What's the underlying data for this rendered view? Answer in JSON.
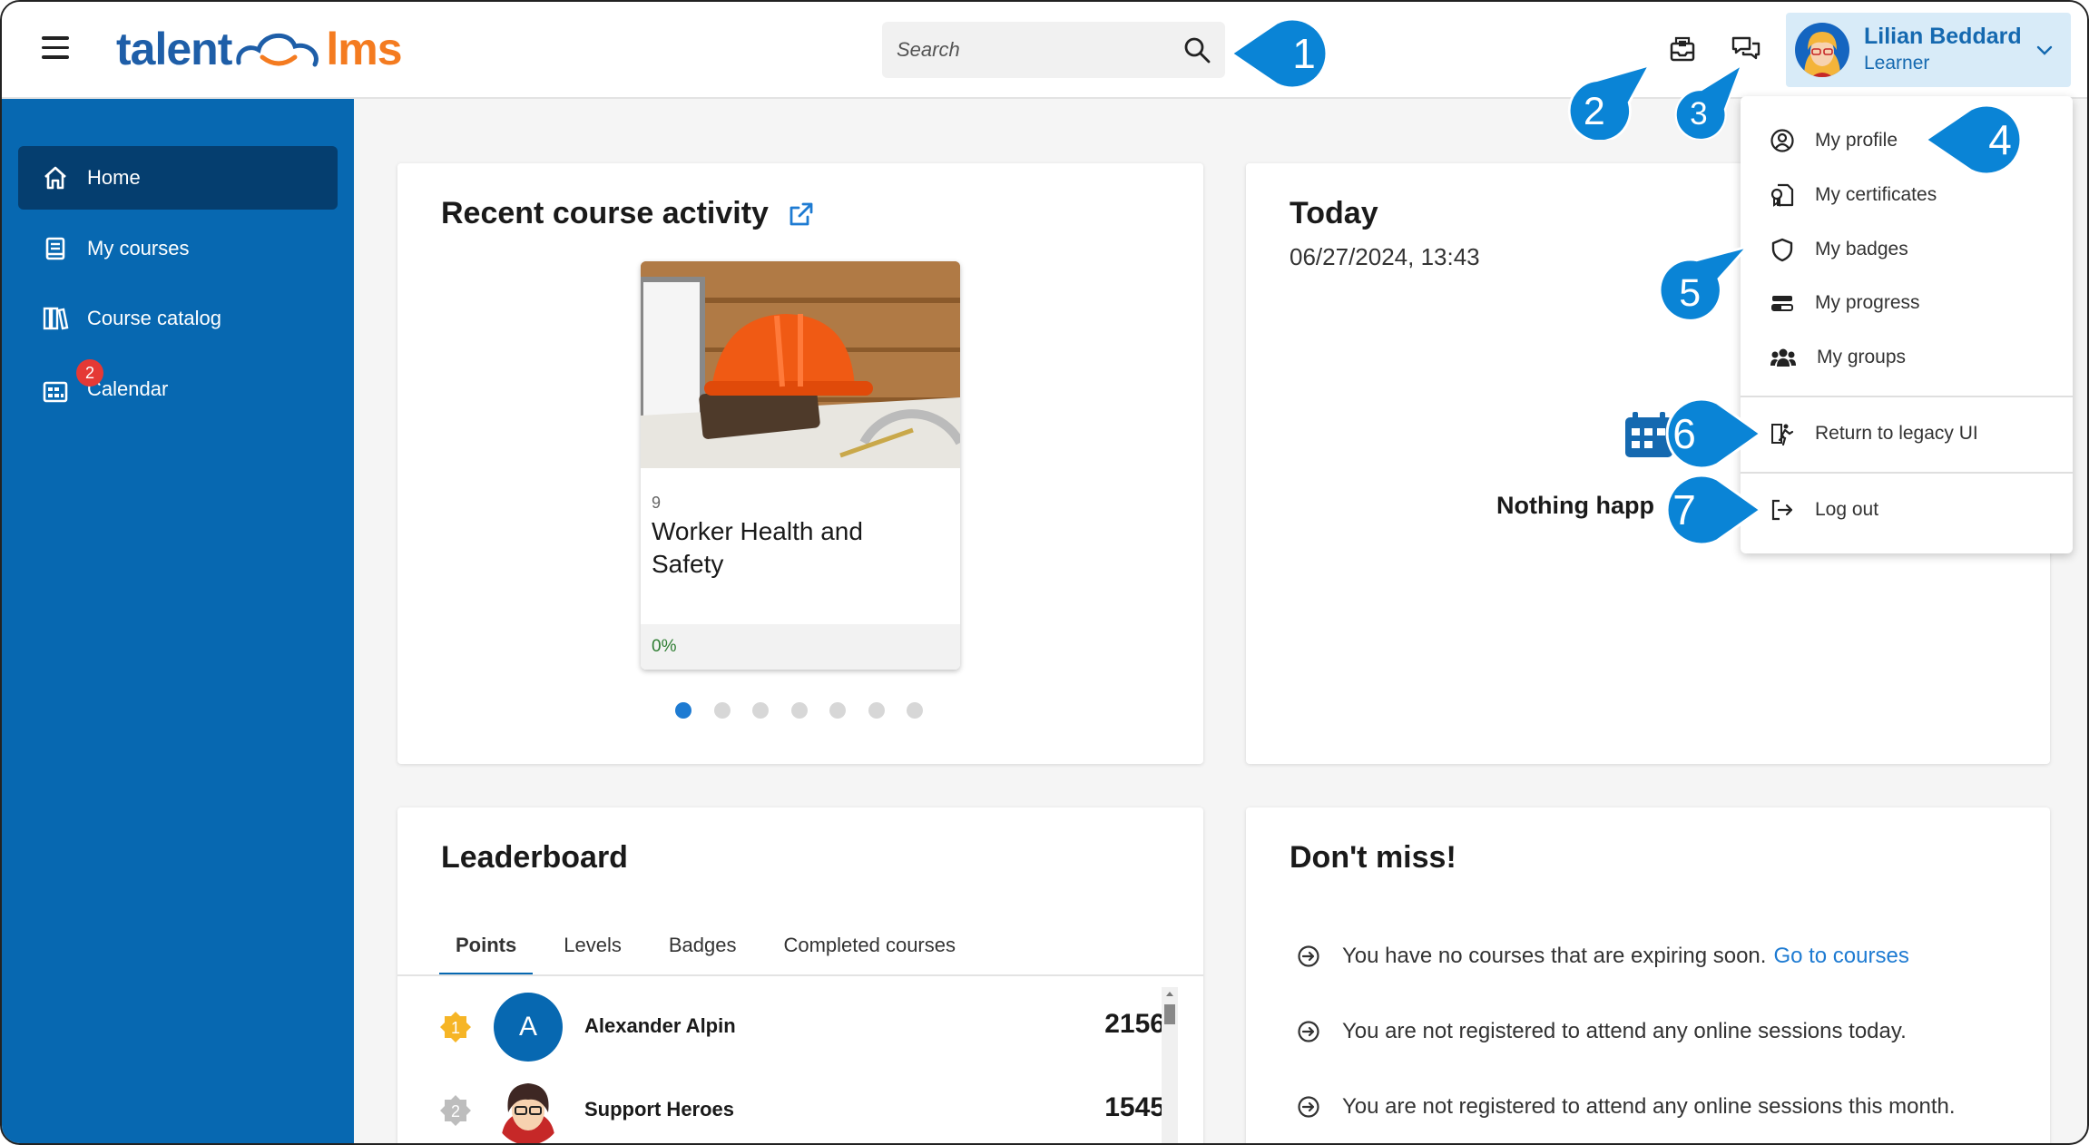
{
  "header": {
    "logo_part1": "talent",
    "logo_part2": "lms",
    "search_placeholder": "Search",
    "user": {
      "name": "Lilian Beddard",
      "role": "Learner"
    }
  },
  "sidebar": {
    "items": [
      {
        "label": "Home",
        "icon": "home-icon",
        "active": true
      },
      {
        "label": "My courses",
        "icon": "book-icon"
      },
      {
        "label": "Course catalog",
        "icon": "library-icon"
      },
      {
        "label": "Calendar",
        "icon": "calendar-icon",
        "badge": "2"
      }
    ]
  },
  "recent": {
    "title": "Recent course activity",
    "course": {
      "number": "9",
      "name": "Worker Health and Safety",
      "progress": "0%"
    },
    "pager": {
      "count": 7,
      "active": 1
    }
  },
  "today": {
    "title": "Today",
    "datetime": "06/27/2024, 13:43",
    "empty_text": "Nothing happ"
  },
  "leaderboard": {
    "title": "Leaderboard",
    "tabs": [
      "Points",
      "Levels",
      "Badges",
      "Completed courses"
    ],
    "active_tab": "Points",
    "rows": [
      {
        "rank": "1",
        "initial": "A",
        "name": "Alexander Alpin",
        "score": "2156"
      },
      {
        "rank": "2",
        "initial": "",
        "name": "Support Heroes",
        "score": "1545"
      }
    ]
  },
  "dontmiss": {
    "title": "Don't miss!",
    "items": [
      {
        "text": "You have no courses that are expiring soon.",
        "link": "Go to courses"
      },
      {
        "text": "You are not registered to attend any online sessions today.",
        "link": ""
      },
      {
        "text": "You are not registered to attend any online sessions this month.",
        "link": ""
      }
    ]
  },
  "dropdown": {
    "items": [
      {
        "label": "My profile",
        "icon": "user-circle-icon"
      },
      {
        "label": "My certificates",
        "icon": "certificate-icon"
      },
      {
        "label": "My badges",
        "icon": "shield-icon"
      },
      {
        "label": "My progress",
        "icon": "progress-icon"
      },
      {
        "label": "My groups",
        "icon": "group-icon"
      },
      {
        "label": "Return to legacy UI",
        "icon": "legacy-icon"
      },
      {
        "label": "Log out",
        "icon": "logout-icon"
      }
    ]
  },
  "callouts": [
    "1",
    "2",
    "3",
    "4",
    "5",
    "6",
    "7"
  ],
  "colors": {
    "brand_blue": "#0768b1",
    "brand_orange": "#f47b20",
    "callout": "#0a84d6"
  }
}
